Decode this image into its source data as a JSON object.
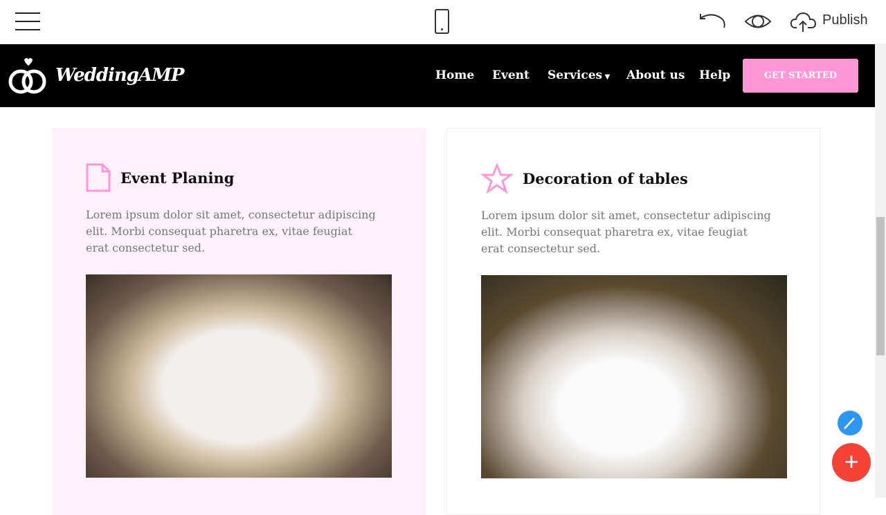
{
  "toolbar": {
    "publish_label": "Publish"
  },
  "nav": {
    "brand": "WeddingAMP",
    "items": [
      "Home",
      "Event",
      "Services",
      "About us",
      "Help"
    ],
    "cta": "GET STARTED"
  },
  "cards": [
    {
      "title": "Event Planing",
      "icon": "file-icon",
      "text": "Lorem ipsum dolor sit amet, consectetur adipiscing elit. Morbi consequat pharetra ex, vitae feugiat erat consectetur sed."
    },
    {
      "title": "Decoration of tables",
      "icon": "star-icon",
      "text": "Lorem ipsum dolor sit amet, consectetur adipiscing elit. Morbi consequat pharetra ex, vitae feugiat erat consectetur sed."
    }
  ],
  "colors": {
    "accent": "#ff97d6",
    "nav_bg": "#000000",
    "card_bg": "#fff0fa"
  }
}
